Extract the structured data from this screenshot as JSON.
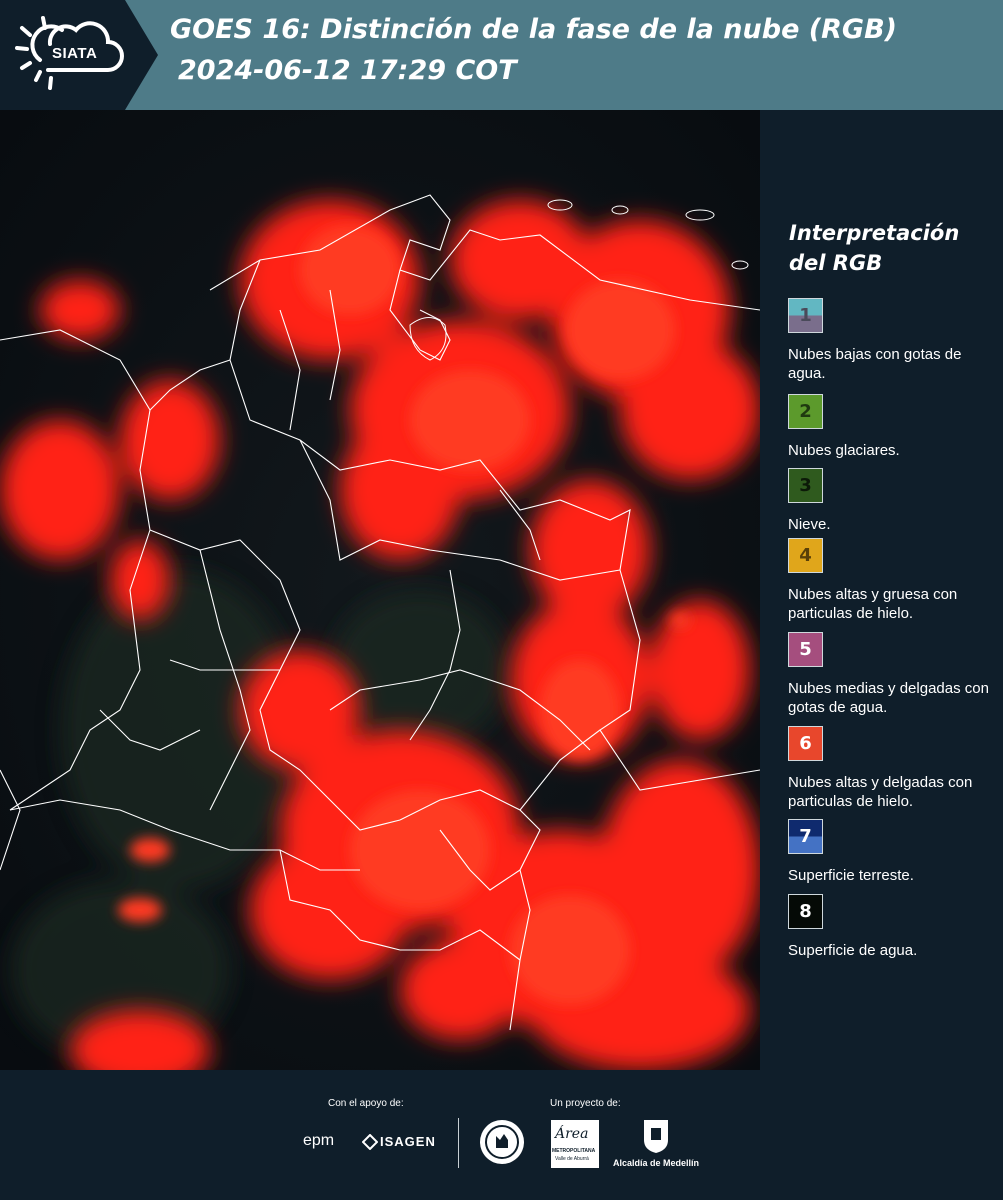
{
  "header": {
    "logo_text": "SIATA",
    "title_line1": "GOES 16: Distinción de la fase de la nube (RGB)",
    "title_line2": "2024-06-12 17:29 COT"
  },
  "legend": {
    "title_line1": "Interpretación",
    "title_line2": "del RGB",
    "items": [
      {
        "number": "1",
        "label": "Nubes bajas con gotas de agua.",
        "color_top": "#62b7c2",
        "color_bottom": "#7a6e8c",
        "text_color": "#4a4a5a"
      },
      {
        "number": "2",
        "label": "Nubes glaciares.",
        "color_top": "#5c9a2c",
        "color_bottom": "#5c9a2c",
        "text_color": "#1f3a10"
      },
      {
        "number": "3",
        "label": "Nieve.",
        "color_top": "#2f5a1e",
        "color_bottom": "#2f5a1e",
        "text_color": "#0c1a08"
      },
      {
        "number": "4",
        "label": "Nubes altas y gruesa con particulas de hielo.",
        "color_top": "#e0a61b",
        "color_bottom": "#e0a61b",
        "text_color": "#5a4008"
      },
      {
        "number": "5",
        "label": "Nubes medias y delgadas con gotas de agua.",
        "color_top": "#a54e7e",
        "color_bottom": "#a54e7e",
        "text_color": "#ffffff"
      },
      {
        "number": "6",
        "label": "Nubes altas y delgadas con particulas de hielo.",
        "color_top": "#e8472c",
        "color_bottom": "#e8472c",
        "text_color": "#ffffff"
      },
      {
        "number": "7",
        "label": "Superficie terreste.",
        "color_top": "#0f2a6e",
        "color_bottom": "#4472c4",
        "text_color": "#ffffff"
      },
      {
        "number": "8",
        "label": "Superficie de agua.",
        "color_top": "#050a06",
        "color_bottom": "#050a06",
        "text_color": "#ffffff"
      }
    ]
  },
  "footer": {
    "support_label": "Con el apoyo de:",
    "project_label": "Un proyecto de:",
    "logo_epm": "epm",
    "logo_isagen": "ISAGEN",
    "logo_metropolitana": "METROPOLITANA",
    "logo_metropolitana_sub": "Valle de Aburrá",
    "logo_area": "Área",
    "logo_alcaldia": "Alcaldía de Medellín"
  },
  "colors": {
    "header_bg": "#4e7b88",
    "panel_bg": "#0f1e2a",
    "cloud_red": "#ff2a1a",
    "border_white": "#ffffff"
  }
}
